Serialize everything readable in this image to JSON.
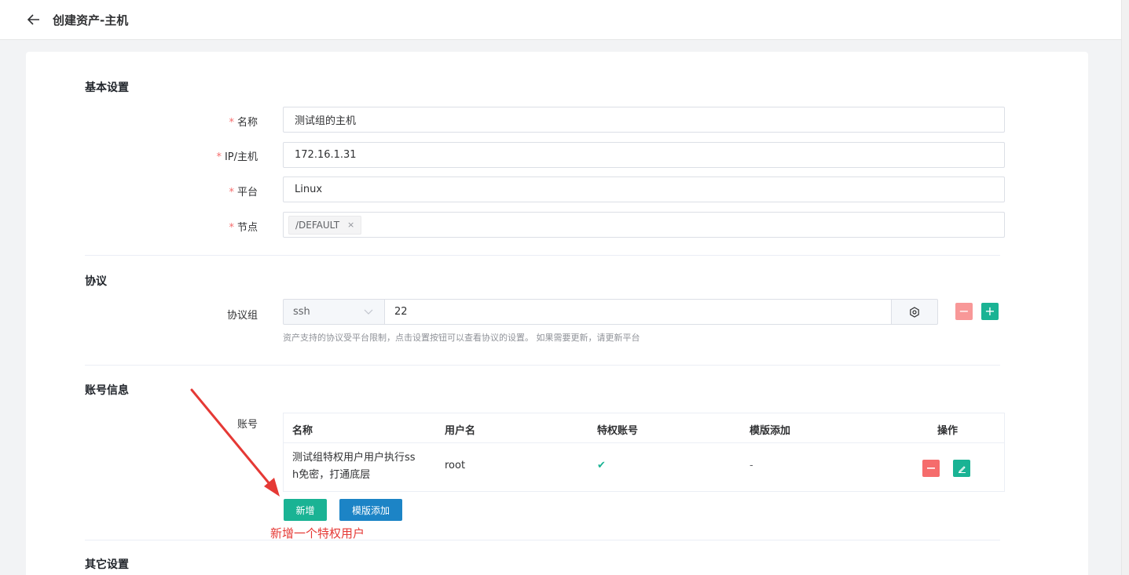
{
  "header": {
    "title": "创建资产-主机"
  },
  "sections": {
    "basic": "基本设置",
    "protocol": "协议",
    "account": "账号信息",
    "other": "其它设置"
  },
  "fields": {
    "name": {
      "label": "名称",
      "value": "测试组的主机"
    },
    "ip": {
      "label": "IP/主机",
      "value": "172.16.1.31"
    },
    "platform": {
      "label": "平台",
      "value": "Linux"
    },
    "node": {
      "label": "节点",
      "tag": "/DEFAULT",
      "tag_close": "×"
    }
  },
  "protocol": {
    "label": "协议组",
    "type": "ssh",
    "port": "22",
    "minus": "−",
    "plus": "+",
    "hint": "资产支持的协议受平台限制，点击设置按钮可以查看协议的设置。 如果需要更新，请更新平台"
  },
  "account": {
    "label": "账号",
    "columns": [
      "名称",
      "用户名",
      "特权账号",
      "模版添加",
      "操作"
    ],
    "rows": [
      {
        "name_line1": "测试组特权用户用户执行ss",
        "name_line2": "h免密，打通底层",
        "username": "root",
        "privileged": "✔",
        "template": "-"
      }
    ],
    "add_button": "新增",
    "template_button": "模版添加"
  },
  "annotation": {
    "text": "新增一个特权用户"
  },
  "colors": {
    "danger": "#f56c6c",
    "danger_light": "#f89898",
    "primary_green": "#1ab394",
    "primary_blue": "#1c84c6",
    "annotation_red": "#e53935"
  }
}
